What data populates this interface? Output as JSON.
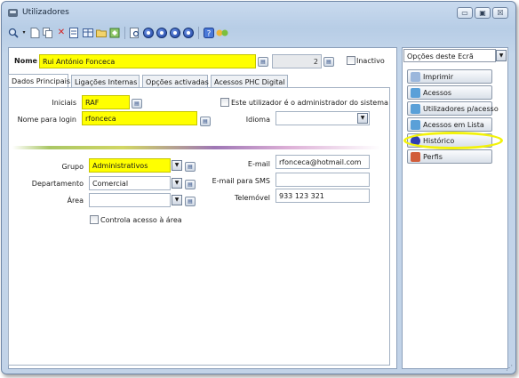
{
  "window": {
    "title": "Utilizadores"
  },
  "titlebar": {
    "minimize": "▭",
    "maximize": "▣",
    "close": "☒"
  },
  "toolbar": {
    "icons": [
      "search-icon",
      "new-document-icon",
      "copy-icon",
      "delete-icon",
      "edit-icon",
      "grid-icon",
      "folder-icon",
      "refresh-icon",
      "preview-icon",
      "first-icon",
      "previous-icon",
      "next-icon",
      "last-icon",
      "help-icon",
      "exit-icon"
    ]
  },
  "header": {
    "name_label": "Nome",
    "name_value": "Rui António Fonceca",
    "number_value": "2",
    "inactive_label": "Inactivo"
  },
  "tabs": [
    {
      "label": "Dados Principais",
      "active": true
    },
    {
      "label": "Ligações Internas",
      "active": false
    },
    {
      "label": "Opções activadas",
      "active": false
    },
    {
      "label": "Acessos PHC Digital",
      "active": false
    }
  ],
  "form": {
    "initials_label": "Iniciais",
    "initials_value": "RAF",
    "login_label": "Nome para login",
    "login_value": "rfonceca",
    "admin_label": "Este utilizador é o administrador do sistema",
    "language_label": "Idioma",
    "language_value": "",
    "group_label": "Grupo",
    "group_value": "Administrativos",
    "department_label": "Departamento",
    "department_value": "Comercial",
    "area_label": "Área",
    "area_value": "",
    "area_control_label": "Controla acesso à área",
    "email_label": "E-mail",
    "email_value": "rfonceca@hotmail.com",
    "sms_label": "E-mail para SMS",
    "sms_value": "",
    "mobile_label": "Telemóvel",
    "mobile_value": "933 123 321"
  },
  "side_panel": {
    "options_label": "Opções deste Ecrã",
    "buttons": [
      {
        "label": "Imprimir",
        "icon": "print-icon",
        "color": "#9cb7dc"
      },
      {
        "label": "Acessos",
        "icon": "access-icon",
        "color": "#5aa0d8"
      },
      {
        "label": "Utilizadores p/acesso",
        "icon": "users-access-icon",
        "color": "#5aa0d8"
      },
      {
        "label": "Acessos em Lista",
        "icon": "access-list-icon",
        "color": "#5aa0d8"
      },
      {
        "label": "Histórico",
        "icon": "history-icon",
        "color": "#2f3fb3"
      },
      {
        "label": "Perfis",
        "icon": "profiles-icon",
        "color": "#d15c3a"
      }
    ]
  },
  "colors": {
    "required_field": "#ffff00",
    "highlight": "#f2f20a"
  }
}
